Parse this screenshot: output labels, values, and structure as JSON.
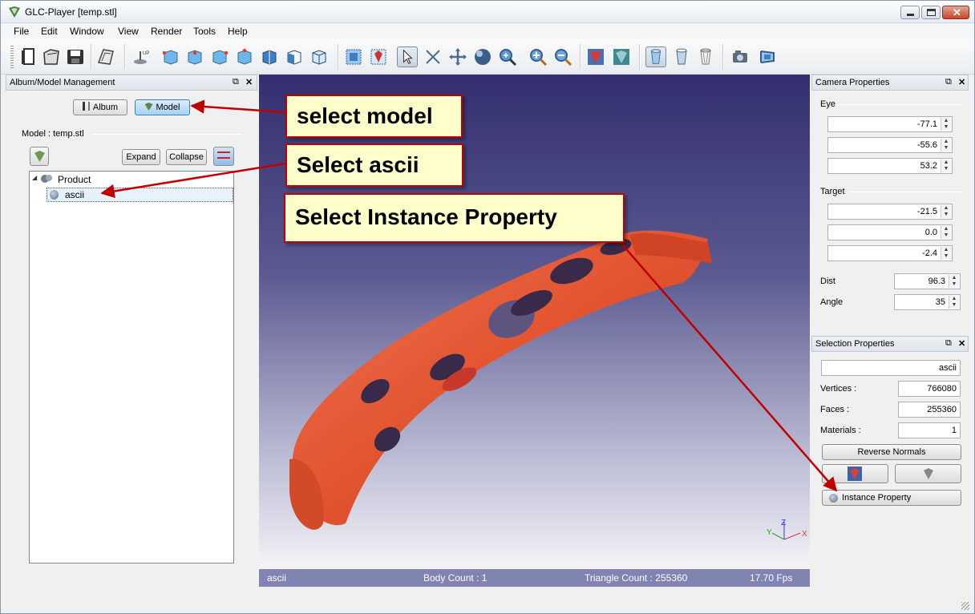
{
  "window": {
    "title": "GLC-Player [temp.stl]"
  },
  "menu": [
    "File",
    "Edit",
    "Window",
    "View",
    "Render",
    "Tools",
    "Help"
  ],
  "left_dock": {
    "title": "Album/Model Management",
    "album_label": "Album",
    "model_label": "Model",
    "model_caption": "Model : temp.stl",
    "expand_label": "Expand",
    "collapse_label": "Collapse",
    "tree": [
      {
        "label": "Product",
        "level": 0
      },
      {
        "label": "ascii",
        "level": 1,
        "selected": true
      }
    ]
  },
  "viewport": {
    "status": {
      "name": "ascii",
      "body_count": "Body Count : 1",
      "triangle_count": "Triangle Count : 255360",
      "fps": "17.70 Fps"
    },
    "axes": {
      "x": "X",
      "y": "Y",
      "z": "Z"
    }
  },
  "camera": {
    "title": "Camera Properties",
    "eye_label": "Eye",
    "eye": [
      "-77.1",
      "-55.6",
      "53.2"
    ],
    "target_label": "Target",
    "target": [
      "-21.5",
      "0.0",
      "-2.4"
    ],
    "dist_label": "Dist",
    "dist": "96.3",
    "angle_label": "Angle",
    "angle": "35"
  },
  "selection": {
    "title": "Selection Properties",
    "name": "ascii",
    "vertices_label": "Vertices :",
    "vertices": "766080",
    "faces_label": "Faces :",
    "faces": "255360",
    "materials_label": "Materials :",
    "materials": "1",
    "reverse_normals_label": "Reverse Normals",
    "instance_property_label": "Instance Property"
  },
  "callouts": {
    "select_model": "select model",
    "select_ascii": "Select ascii",
    "select_instance": "Select Instance Property"
  },
  "colors": {
    "accent": "#3c7fb1",
    "model": "#e2542f",
    "callout_border": "#c00000",
    "callout_bg": "#ffffcc"
  }
}
